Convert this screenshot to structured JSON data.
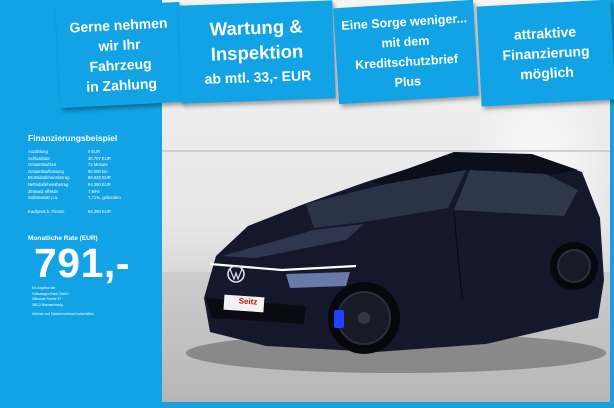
{
  "banners": [
    {
      "lines": [
        "Gerne nehmen",
        "wir Ihr",
        "Fahrzeug",
        "in Zahlung"
      ]
    },
    {
      "lines": [
        "Wartung &",
        "Inspektion",
        "ab mtl. 33,- EUR"
      ]
    },
    {
      "lines": [
        "Eine Sorge weniger...",
        "mit dem",
        "Kreditschutzbrief",
        "Plus"
      ]
    },
    {
      "lines": [
        "attraktive",
        "Finanzierung",
        "möglich"
      ]
    }
  ],
  "financing": {
    "title": "Finanzierungsbeispiel",
    "rows": [
      {
        "label": "Anzahlung",
        "value": "0 EUR"
      },
      {
        "label": "Schlussrate",
        "value": "30.707 EUR"
      },
      {
        "label": "Gesamtlaufzeit",
        "value": "72 Monate"
      },
      {
        "label": "Gesamtlaufleistung",
        "value": "60.000 km"
      },
      {
        "label": "Bruttodarlehensbetrag",
        "value": "86.628 EUR"
      },
      {
        "label": "Nettodarlehensbetrag",
        "value": "64.390 EUR"
      },
      {
        "label": "Zinssatz effektiv",
        "value": "7,99%"
      },
      {
        "label": "Sollzinssatz p.a.",
        "value": "7,71%, gebunden"
      }
    ],
    "kaufpreis_label": "Kaufpreis b. Finanz.",
    "kaufpreis_value": "64.390 EUR",
    "rate_label": "Monatliche Rate (EUR)",
    "rate_value": "791,-",
    "offer_lines": [
      "Ein Angebot der",
      "Volkswagen Bank GmbH",
      "Gifhorner Straße 57",
      "38112 Braunschweig"
    ],
    "footnote": "Irrtümer und Zwischenverkauf vorbehalten"
  },
  "plate_text": "Seitz",
  "colors": {
    "accent": "#12a3e6",
    "car_body": "#15182a",
    "brake_caliper": "#2340ff"
  }
}
